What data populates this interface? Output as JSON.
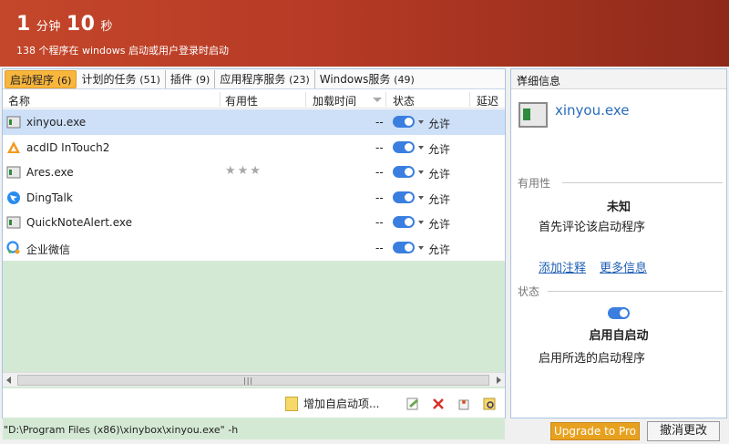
{
  "header": {
    "minutes": "1",
    "minutes_unit": "分钟",
    "seconds": "10",
    "seconds_unit": "秒",
    "subtitle": "138 个程序在 windows 启动或用户登录时启动"
  },
  "tabs": [
    {
      "label": "启动程序",
      "count": "(6)"
    },
    {
      "label": "计划的任务",
      "count": "(51)"
    },
    {
      "label": "插件",
      "count": "(9)"
    },
    {
      "label": "应用程序服务",
      "count": "(23)"
    },
    {
      "label": "Windows服务",
      "count": "(49)"
    }
  ],
  "columns": {
    "name": "名称",
    "usefulness": "有用性",
    "load_time": "加载时间",
    "status": "状态",
    "delay": "延迟时"
  },
  "rows": [
    {
      "name": "xinyou.exe",
      "load": "--",
      "status": "允许",
      "icon": "window-app-icon"
    },
    {
      "name": "acdID InTouch2",
      "load": "--",
      "status": "允许",
      "icon": "acd-triangle-icon"
    },
    {
      "name": "Ares.exe",
      "load": "--",
      "status": "允许",
      "icon": "window-app-icon",
      "stars": "★★★"
    },
    {
      "name": "DingTalk",
      "load": "--",
      "status": "允许",
      "icon": "dingtalk-icon"
    },
    {
      "name": "QuickNoteAlert.exe",
      "load": "--",
      "status": "允许",
      "icon": "window-app-icon"
    },
    {
      "name": "企业微信",
      "load": "--",
      "status": "允许",
      "icon": "wecom-icon"
    }
  ],
  "toolbar": {
    "add_label": "增加自启动项..."
  },
  "details": {
    "title": "详细信息",
    "app_name": "xinyou.exe",
    "usefulness_label": "有用性",
    "usefulness_value": "未知",
    "usefulness_hint": "首先评论该启动程序",
    "add_note": "添加注释",
    "more_info": "更多信息",
    "status_label": "状态",
    "status_value": "启用自启动",
    "status_hint": "启用所选的启动程序"
  },
  "footer": {
    "command_line": "\"D:\\Program Files (x86)\\xinybox\\xinyou.exe\" -h",
    "upgrade_label": "Upgrade to Pro",
    "cancel_label": "撤消更改"
  },
  "colors": {
    "header_red": "#c4472b",
    "accent_orange": "#f9b63d",
    "selection_blue": "#cde0f7",
    "toggle_blue": "#3a7fe0",
    "empty_area_green": "#d4e9d4",
    "link_blue": "#1f5fb4"
  }
}
